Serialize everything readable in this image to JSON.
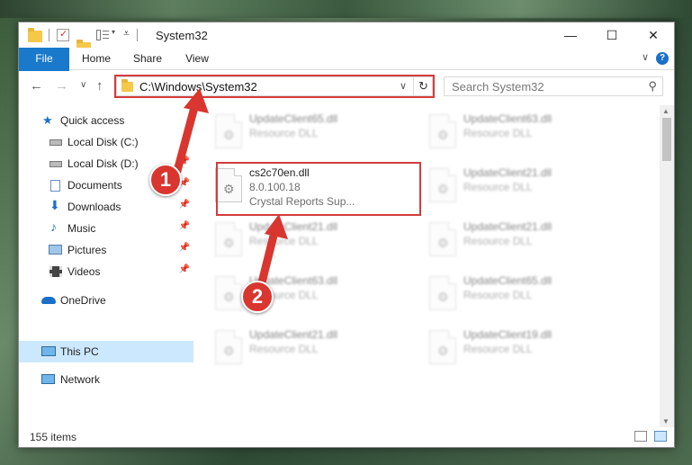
{
  "window": {
    "title": "System32",
    "minimize": "—",
    "maximize": "☐",
    "close": "✕"
  },
  "ribbon": {
    "tabs": [
      "File",
      "Home",
      "Share",
      "View"
    ],
    "help": "?",
    "expand": "∨"
  },
  "nav": {
    "back": "←",
    "forward": "→",
    "recent": "∨",
    "up": "↑",
    "address": "C:\\Windows\\System32",
    "refresh": "↻",
    "search_placeholder": "Search System32",
    "search_icon": "⚲"
  },
  "sidebar": {
    "items": [
      {
        "label": "Quick access",
        "icon": "star-icon"
      },
      {
        "label": "Local Disk (C:)",
        "icon": "drive-icon"
      },
      {
        "label": "Local Disk (D:)",
        "icon": "drive-icon"
      },
      {
        "label": "Documents",
        "icon": "documents-icon"
      },
      {
        "label": "Downloads",
        "icon": "downloads-icon"
      },
      {
        "label": "Music",
        "icon": "music-icon"
      },
      {
        "label": "Pictures",
        "icon": "pictures-icon"
      },
      {
        "label": "Videos",
        "icon": "videos-icon"
      },
      {
        "label": "OneDrive",
        "icon": "cloud-icon"
      },
      {
        "label": "This PC",
        "icon": "computer-icon"
      },
      {
        "label": "Network",
        "icon": "network-icon"
      }
    ],
    "pin": "📌"
  },
  "files": [
    {
      "name": "UpdateClient65.dll",
      "line2": "Resource DLL",
      "line3": ""
    },
    {
      "name": "UpdateClient63.dll",
      "line2": "Resource DLL",
      "line3": ""
    },
    {
      "name": "cs2c70en.dll",
      "line2": "8.0.100.18",
      "line3": "Crystal Reports Sup..."
    },
    {
      "name": "UpdateClient21.dll",
      "line2": "Resource DLL",
      "line3": ""
    },
    {
      "name": "UpdateClient21.dll",
      "line2": "Resource DLL",
      "line3": ""
    },
    {
      "name": "UpdateClient21.dll",
      "line2": "Resource DLL",
      "line3": ""
    },
    {
      "name": "UpdateClient63.dll",
      "line2": "Resource DLL",
      "line3": ""
    },
    {
      "name": "UpdateClient65.dll",
      "line2": "Resource DLL",
      "line3": ""
    },
    {
      "name": "UpdateClient21.dll",
      "line2": "Resource DLL",
      "line3": ""
    },
    {
      "name": "UpdateClient19.dll",
      "line2": "Resource DLL",
      "line3": ""
    }
  ],
  "status": {
    "count": "155 items"
  },
  "callouts": {
    "one": "1",
    "two": "2"
  },
  "colors": {
    "accent": "#1979ca",
    "highlight": "#d23c3c",
    "callout": "#d9362f",
    "selection": "#cce8ff"
  }
}
